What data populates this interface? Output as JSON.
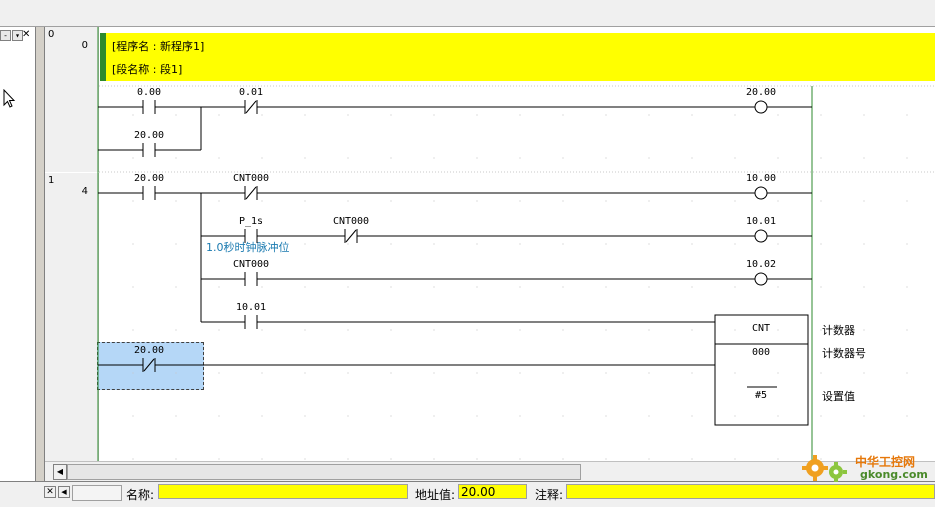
{
  "program_header": {
    "program_name_line": "[程序名 : 新程序1]",
    "section_name_line": "[段名称 : 段1]"
  },
  "rungs": [
    {
      "number": "0",
      "step": "0"
    },
    {
      "number": "1",
      "step": "4"
    }
  ],
  "contacts": {
    "r0_c1": "0.00",
    "r0_c2": "0.01",
    "r0_c3": "20.00",
    "r1_c1": "20.00",
    "r1_c2": "CNT000",
    "r1_c3": "P_1s",
    "r1_c4": "CNT000",
    "r1_c5": "CNT000",
    "r1_c6": "10.01",
    "r1_c7": "20.00"
  },
  "coils": {
    "r0_coil": "20.00",
    "r1_coil1": "10.00",
    "r1_coil2": "10.01",
    "r1_coil3": "10.02"
  },
  "comment_pulse": "1.0秒时钟脉冲位",
  "counter_block": {
    "type_label": "CNT",
    "number": "000",
    "setpoint": "#5",
    "label_counter": "计数器",
    "label_counter_no": "计数器号",
    "label_setpoint": "设置值"
  },
  "status_bar": {
    "name_label": "名称:",
    "name_value": "",
    "address_label": "地址值:",
    "address_value": "20.00",
    "comment_label": "注释:",
    "comment_value": ""
  },
  "watermark": {
    "top_text": "中华工控网",
    "bottom_text": "gkong.com"
  },
  "colors": {
    "header_bg": "#ffff00",
    "header_accent": "#2d8a2d",
    "selection": "#b5d7f7",
    "comment": "#1a7ab0"
  }
}
